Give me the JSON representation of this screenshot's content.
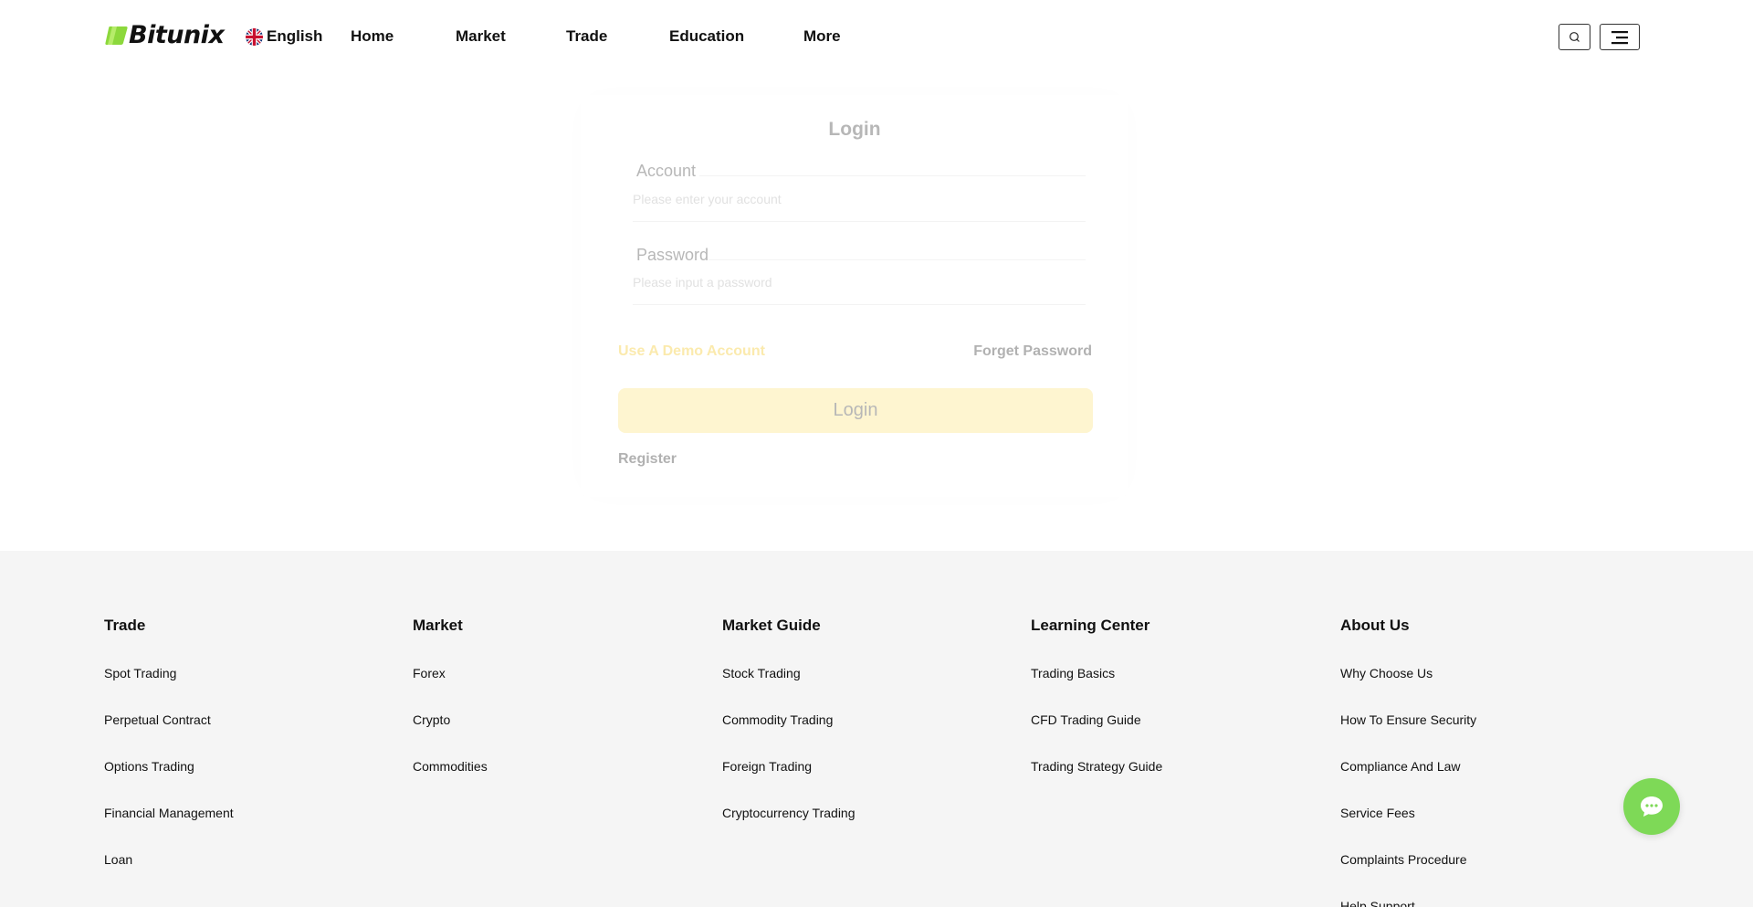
{
  "brand": {
    "name": "Bitunix",
    "accent": "#8cd83c"
  },
  "header": {
    "language": "English",
    "nav": [
      "Home",
      "Market",
      "Trade",
      "Education",
      "More"
    ],
    "icons": [
      "search-icon",
      "menu-icon"
    ]
  },
  "login": {
    "title": "Login",
    "account_label": "Account",
    "account_placeholder": "Please enter your account",
    "password_label": "Password",
    "password_placeholder": "Please input a password",
    "demo_link": "Use A Demo Account",
    "forget_link": "Forget Password",
    "submit_label": "Login",
    "register_link": "Register",
    "button_color": "#fde47a",
    "demo_color": "#f5c518"
  },
  "footer": {
    "columns": [
      {
        "heading": "Trade",
        "links": [
          "Spot Trading",
          "Perpetual Contract",
          "Options Trading",
          "Financial Management",
          "Loan"
        ]
      },
      {
        "heading": "Market",
        "links": [
          "Forex",
          "Crypto",
          "Commodities"
        ]
      },
      {
        "heading": "Market Guide",
        "links": [
          "Stock Trading",
          "Commodity Trading",
          "Foreign Trading",
          "Cryptocurrency Trading"
        ]
      },
      {
        "heading": "Learning Center",
        "links": [
          "Trading Basics",
          "CFD Trading Guide",
          "Trading Strategy Guide"
        ]
      },
      {
        "heading": "About Us",
        "links": [
          "Why Choose Us",
          "How To Ensure Security",
          "Compliance And Law",
          "Service Fees",
          "Complaints Procedure",
          "Help Support"
        ]
      }
    ]
  },
  "chat": {
    "icon": "chat-bubble-icon",
    "color": "#7ed957"
  }
}
